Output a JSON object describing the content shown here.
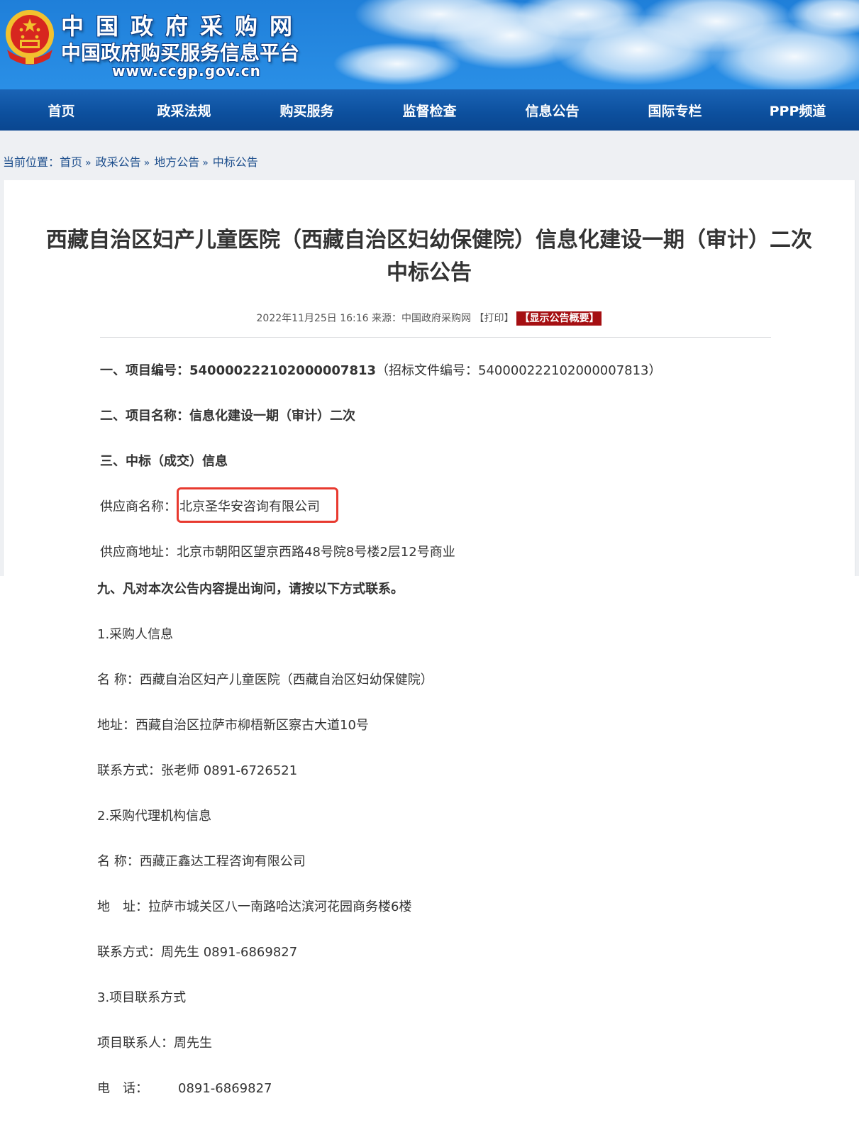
{
  "header": {
    "site_name": "中国政府采购网",
    "site_subtitle": "中国政府购买服务信息平台",
    "site_url": "www.ccgp.gov.cn",
    "colors": {
      "banner_blue": "#1a73d1",
      "nav_blue": "#0c4f9d",
      "emblem_red": "#d7261f",
      "emblem_gold": "#f2c12e"
    },
    "emblem_icon": "national-emblem-icon"
  },
  "nav": {
    "items": [
      "首页",
      "政采法规",
      "购买服务",
      "监督检查",
      "信息公告",
      "国际专栏",
      "PPP频道"
    ]
  },
  "breadcrumb": {
    "prefix": "当前位置：",
    "items": [
      "首页",
      "政采公告",
      "地方公告",
      "中标公告"
    ],
    "separator": "»"
  },
  "article": {
    "title_line1": "西藏自治区妇产儿童医院（西藏自治区妇幼保健院）信息化建设一期（审计）二次",
    "title_line2": "中标公告",
    "meta": {
      "datetime": "2022年11月25日 16:16",
      "source_label": "来源：",
      "source": "中国政府采购网",
      "print_label": "【打印】",
      "summary_button": "【显示公告概要】",
      "summary_button_color": "#a50f12"
    },
    "section1_label": "一、项目编号：",
    "section1_value": "540000222102000007813",
    "section1_extra": "（招标文件编号：540000222102000007813）",
    "section2_label": "二、项目名称：",
    "section2_value": "信息化建设一期（审计）二次",
    "section3_label": "三、中标（成交）信息",
    "supplier_name_label": "供应商名称：",
    "supplier_name": "北京圣华安咨询有限公司",
    "supplier_address_label": "供应商地址：",
    "supplier_address": "北京市朝阳区望京西路48号院8号楼2层12号商业",
    "highlight_color": "#e8392f"
  },
  "contact": {
    "section9": "九、凡对本次公告内容提出询问，请按以下方式联系。",
    "purchaser_heading": "1.采购人信息",
    "purchaser_name_label": "名 称：",
    "purchaser_name": "西藏自治区妇产儿童医院（西藏自治区妇幼保健院）",
    "purchaser_address_label": "地址：",
    "purchaser_address": "西藏自治区拉萨市柳梧新区察古大道10号",
    "purchaser_contact_label": "联系方式：",
    "purchaser_contact": "张老师 0891-6726521",
    "agency_heading": "2.采购代理机构信息",
    "agency_name_label": "名 称：",
    "agency_name": "西藏正鑫达工程咨询有限公司",
    "agency_address_label": "地　址：",
    "agency_address": "拉萨市城关区八一南路哈达滨河花园商务楼6楼",
    "agency_contact_label": "联系方式：",
    "agency_contact": "周先生 0891-6869827",
    "project_heading": "3.项目联系方式",
    "project_contact_label": "项目联系人：",
    "project_contact": "周先生",
    "phone_label": "电　话：",
    "phone": "0891-6869827"
  }
}
